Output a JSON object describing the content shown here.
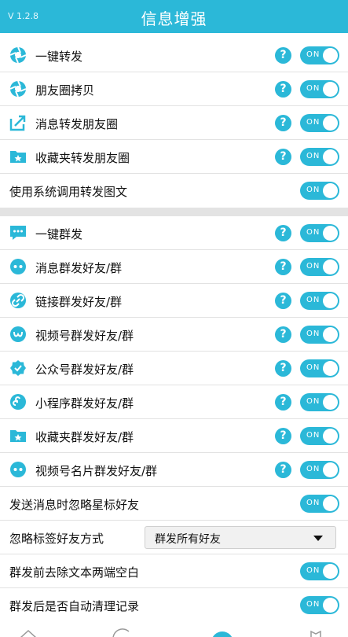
{
  "header": {
    "version": "V 1.2.8",
    "title": "信息增强"
  },
  "rows": [
    {
      "label": "一键转发",
      "icon": "shutter-icon",
      "help": "?",
      "toggle": "ON"
    },
    {
      "label": "朋友圈拷贝",
      "icon": "shutter-icon",
      "help": "?",
      "toggle": "ON"
    },
    {
      "label": "消息转发朋友圈",
      "icon": "share-icon",
      "help": "?",
      "toggle": "ON"
    },
    {
      "label": "收藏夹转发朋友圈",
      "icon": "folder-star-icon",
      "help": "?",
      "toggle": "ON"
    },
    {
      "label": "使用系统调用转发图文",
      "toggle": "ON"
    },
    {
      "label": "一键群发",
      "icon": "chat-bubble-icon",
      "help": "?",
      "toggle": "ON"
    },
    {
      "label": "消息群发好友/群",
      "icon": "message-dots-icon",
      "help": "?",
      "toggle": "ON"
    },
    {
      "label": "链接群发好友/群",
      "icon": "link-icon",
      "help": "?",
      "toggle": "ON"
    },
    {
      "label": "视频号群发好友/群",
      "icon": "channels-icon",
      "help": "?",
      "toggle": "ON"
    },
    {
      "label": "公众号群发好友/群",
      "icon": "verified-badge-icon",
      "help": "?",
      "toggle": "ON"
    },
    {
      "label": "小程序群发好友/群",
      "icon": "mini-program-icon",
      "help": "?",
      "toggle": "ON"
    },
    {
      "label": "收藏夹群发好友/群",
      "icon": "folder-star-icon",
      "help": "?",
      "toggle": "ON"
    },
    {
      "label": "视频号名片群发好友/群",
      "icon": "message-dots-icon",
      "help": "?",
      "toggle": "ON"
    },
    {
      "label": "发送消息时忽略星标好友",
      "toggle": "ON"
    },
    {
      "label": "忽略标签好友方式",
      "select_value": "群发所有好友"
    },
    {
      "label": "群发前去除文本两端空白",
      "toggle": "ON"
    },
    {
      "label": "群发后是否自动清理记录",
      "toggle": "ON"
    }
  ],
  "colors": {
    "accent": "#2bb8d8",
    "separator": "#e3e3e3"
  }
}
